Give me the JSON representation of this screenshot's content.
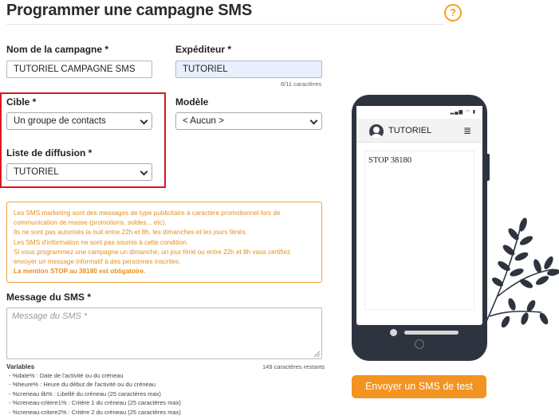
{
  "page": {
    "title": "Programmer une campagne SMS",
    "help_label": "?"
  },
  "form": {
    "campaign_name": {
      "label": "Nom de la campagne *",
      "value": "TUTORIEL CAMPAGNE SMS"
    },
    "sender": {
      "label": "Expéditeur *",
      "value": "TUTORIEL",
      "counter": "8/11 caractères"
    },
    "target": {
      "label": "Cible *",
      "value": "Un groupe de contacts"
    },
    "template": {
      "label": "Modèle",
      "value": "< Aucun >"
    },
    "list": {
      "label": "Liste de diffusion *",
      "value": "TUTORIEL"
    }
  },
  "info": {
    "lines": [
      "Les SMS marketing sont des messages de type publicitaire à caractère promotionnel lors de communication de masse (promotions, soldes... etc).",
      "Ils ne sont pas autorisés la nuit entre 22h et 8h, les dimanches et les jours fériés.",
      "Les SMS d'information ne sont pas soumis à cette condition.",
      "Si vous programmez une campagne un dimanche, un jour férié ou entre 22h et 8h vous certifiez envoyer un message informatif à des personnes inscrites."
    ],
    "strong_line": "La mention STOP au 38180 est obligatoire."
  },
  "message": {
    "label": "Message du SMS *",
    "placeholder": "Message du SMS *",
    "remaining": "149 caractères restants"
  },
  "variables": {
    "title": "Variables",
    "items": [
      "- %date% : Date de l'activité ou du créneau",
      "- %heure% : Heure du début de l'activité ou du créneau",
      "- %creneau lib% : Libellé du créneau (25 caractères max)",
      "- %creneau-critere1% : Critère 1 du créneau (25 caractères max)",
      "- %creneau-critere2% : Critère 2 du créneau (25 caractères max)"
    ]
  },
  "phone": {
    "sender": "TUTORIEL",
    "message": "STOP 38180",
    "status_time": "",
    "status_icons": "▂▄▆ ◠ ▮"
  },
  "actions": {
    "send_test": "Envoyer un SMS de test"
  },
  "colors": {
    "accent": "#f39321",
    "info_text": "#e88d1a",
    "highlight_box": "#d4191f",
    "phone_body": "#2e3340"
  }
}
